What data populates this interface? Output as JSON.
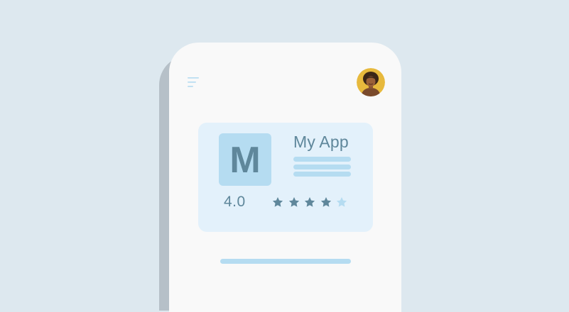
{
  "app_card": {
    "icon_letter": "M",
    "name": "My App",
    "rating_text": "4.0",
    "rating_value": 4,
    "rating_max": 5
  },
  "header": {
    "menu_icon": "hamburger-menu-icon",
    "avatar": "user-avatar"
  },
  "colors": {
    "background": "#dde8ef",
    "phone": "#f9f9f9",
    "card": "#e3f1fb",
    "accent_light": "#b5dcf1",
    "accent_dark": "#5f879b"
  }
}
